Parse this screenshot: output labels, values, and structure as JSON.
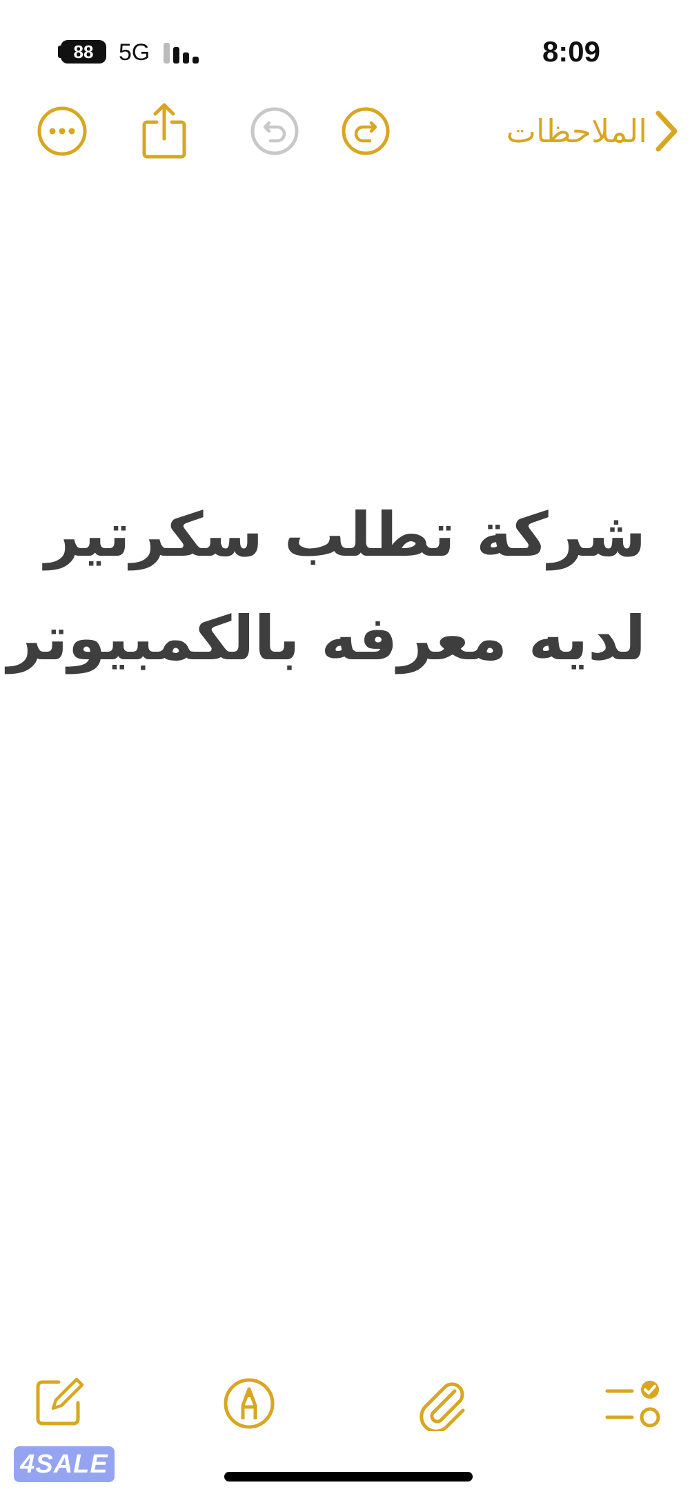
{
  "status_bar": {
    "battery_level": "88",
    "network": "5G",
    "time": "8:09"
  },
  "toolbar": {
    "back_label": "الملاحظات",
    "icons": {
      "more": "more-ellipsis-icon",
      "share": "share-icon",
      "undo": "undo-icon",
      "redo": "redo-icon",
      "back": "chevron-right-icon"
    }
  },
  "note": {
    "lines": [
      "شركة تطلب سكرتير",
      "لديه معرفه بالكمبيوتر"
    ]
  },
  "bottom_toolbar": {
    "icons": {
      "compose": "compose-icon",
      "markup": "markup-pen-icon",
      "attach": "paperclip-icon",
      "checklist": "checklist-icon"
    }
  },
  "watermark": {
    "text": "4SALE"
  },
  "colors": {
    "accent": "#D9A621",
    "disabled": "#C8C8C8",
    "text": "#3E3E3E",
    "background": "#FFFFFF"
  }
}
